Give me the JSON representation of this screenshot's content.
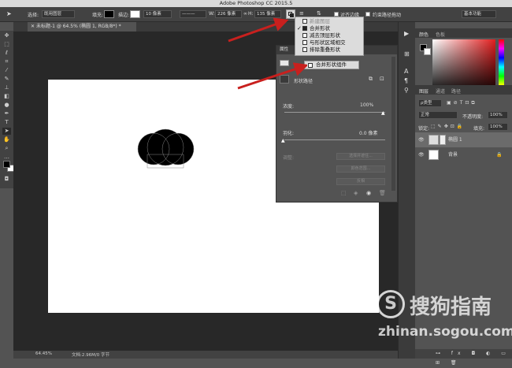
{
  "app_title": "Adobe Photoshop CC 2015.5",
  "options": {
    "select_label": "选择:",
    "select_value": "既用图层",
    "fill_label": "填充:",
    "stroke_label": "描边:",
    "stroke_size": "10 像素",
    "w_label": "W:",
    "w_value": "226 像素",
    "h_label": "H:",
    "h_value": "135 像素",
    "align_edges": "对齐边缘",
    "constrain": "约束路径拖动",
    "workspace": "基本功能"
  },
  "doc_tab": "未标题-1 @ 64.5% (椭圆 1, RGB/8*) *",
  "path_ops_menu": {
    "items": [
      "新建图层",
      "合并形状",
      "减去顶层形状",
      "与形状区域相交",
      "排除重叠形状"
    ],
    "checked_index": 1,
    "disabled_index": 0
  },
  "merge_components": "合并形状组件",
  "properties": {
    "title": "属性",
    "shape_path": "形状路径",
    "density_label": "浓度:",
    "density_value": "100%",
    "feather_label": "羽化:",
    "feather_value": "0.0 像素",
    "mask_label": "调整:",
    "select_edge": "选择并遮住...",
    "color_range": "颜色范围...",
    "invert": "反相"
  },
  "status": {
    "zoom": "64.45%",
    "doc": "文档:2.96M/0 字节"
  },
  "right_panel": {
    "color_tab": "颜色",
    "swatches_tab": "色板",
    "layers_tab": "图层",
    "channels_tab": "通道",
    "paths_tab": "路径",
    "filter_kind": "ρ类型",
    "blend_mode": "正常",
    "opacity_label": "不透明度:",
    "opacity_value": "100%",
    "lock_label": "锁定:",
    "fill_label": "填充:",
    "fill_value": "100%",
    "layers": [
      {
        "name": "椭圆 1",
        "selected": true
      },
      {
        "name": "背景",
        "selected": false
      }
    ]
  },
  "watermark": {
    "brand": "搜狗指南",
    "url": "zhinan.sogou.com"
  },
  "colors": {
    "arrow": "#c8201e",
    "foreground": "#000000",
    "background": "#ffffff"
  }
}
